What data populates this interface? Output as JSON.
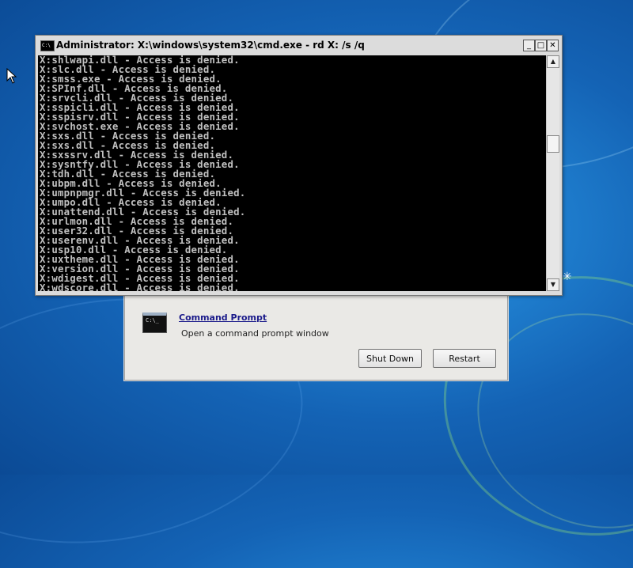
{
  "desktop": {
    "sparkle_glyph": "✳"
  },
  "recovery": {
    "tool_name": "Command Prompt",
    "tool_description": "Open a command prompt window",
    "icon_text": "C:\\_",
    "shutdown_label": "Shut Down",
    "restart_label": "Restart"
  },
  "console": {
    "title": "Administrator: X:\\windows\\system32\\cmd.exe - rd  X: /s /q",
    "icon_text": "C:\\",
    "minimize_glyph": "_",
    "maximize_glyph": "□",
    "close_glyph": "✕",
    "scroll_up_glyph": "▲",
    "scroll_down_glyph": "▼",
    "scroll_position": 0.35,
    "lines": [
      "X:shlwapi.dll - Access is denied.",
      "X:slc.dll - Access is denied.",
      "X:smss.exe - Access is denied.",
      "X:SPInf.dll - Access is denied.",
      "X:srvcli.dll - Access is denied.",
      "X:sspicli.dll - Access is denied.",
      "X:sspisrv.dll - Access is denied.",
      "X:svchost.exe - Access is denied.",
      "X:sxs.dll - Access is denied.",
      "X:sxs.dll - Access is denied.",
      "X:sxssrv.dll - Access is denied.",
      "X:sysntfy.dll - Access is denied.",
      "X:tdh.dll - Access is denied.",
      "X:ubpm.dll - Access is denied.",
      "X:umpnpmgr.dll - Access is denied.",
      "X:umpo.dll - Access is denied.",
      "X:unattend.dll - Access is denied.",
      "X:urlmon.dll - Access is denied.",
      "X:user32.dll - Access is denied.",
      "X:userenv.dll - Access is denied.",
      "X:usp10.dll - Access is denied.",
      "X:uxtheme.dll - Access is denied.",
      "X:version.dll - Access is denied.",
      "X:wdigest.dll - Access is denied.",
      "X:wdscore.dll - Access is denied."
    ]
  }
}
